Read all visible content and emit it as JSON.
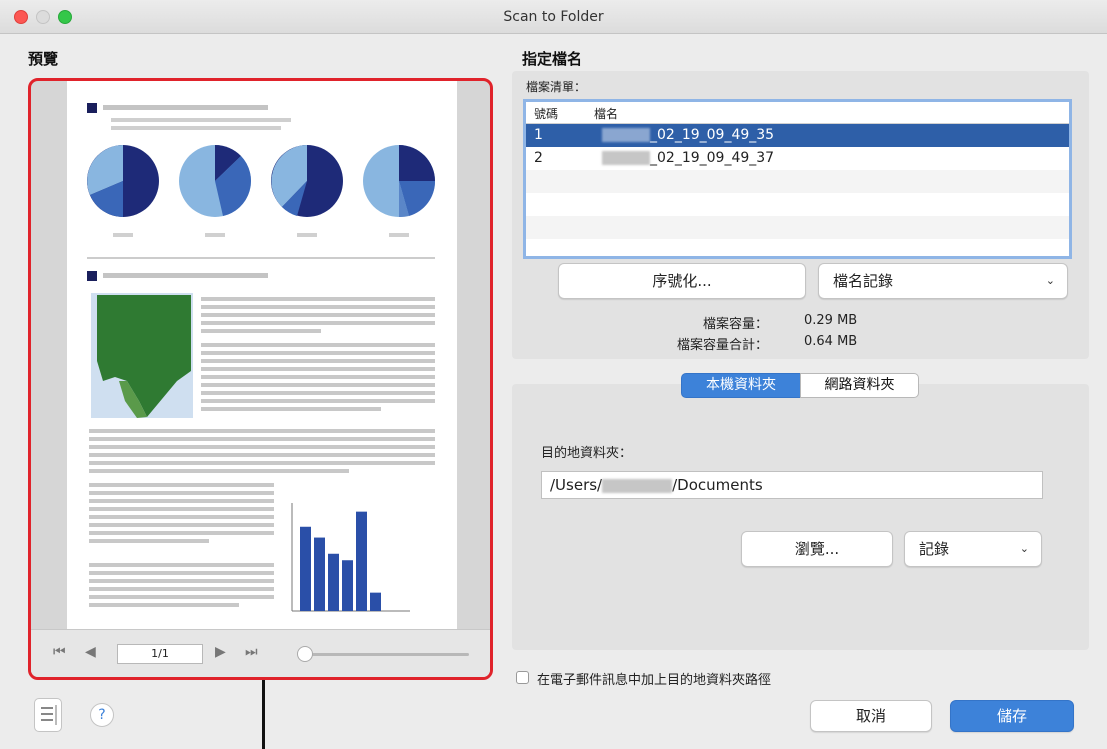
{
  "window": {
    "title": "Scan to Folder"
  },
  "preview": {
    "label": "預覽",
    "page_indicator": "1/1"
  },
  "file_naming": {
    "label": "指定檔名",
    "list_label": "檔案清單：",
    "columns": [
      "號碼",
      "檔名"
    ],
    "rows": [
      {
        "number": "1",
        "name": "_02_19_09_49_35"
      },
      {
        "number": "2",
        "name": "_02_19_09_49_37"
      }
    ],
    "serialize_button": "序號化...",
    "history_select": "檔名記錄",
    "file_size_label": "檔案容量：",
    "file_size_value": "0.29  MB",
    "total_size_label": "檔案容量合計：",
    "total_size_value": "0.64  MB"
  },
  "folder_tabs": {
    "local": "本機資料夾",
    "network": "網路資料夾"
  },
  "destination": {
    "label": "目的地資料夾：",
    "path_prefix": "/Users/",
    "path_suffix": "/Documents",
    "browse_button": "瀏覽...",
    "history_select": "記錄"
  },
  "email_option": {
    "label": "在電子郵件訊息中加上目的地資料夾路徑"
  },
  "footer": {
    "cancel": "取消",
    "save": "儲存"
  },
  "preview_chart": {
    "title": "",
    "values": [
      78,
      68,
      53,
      47,
      92,
      17
    ],
    "ylim": [
      0,
      100
    ]
  },
  "colors": {
    "accent": "#3d82d9",
    "highlight": "#e0232b",
    "selection": "#2e5fa8"
  }
}
